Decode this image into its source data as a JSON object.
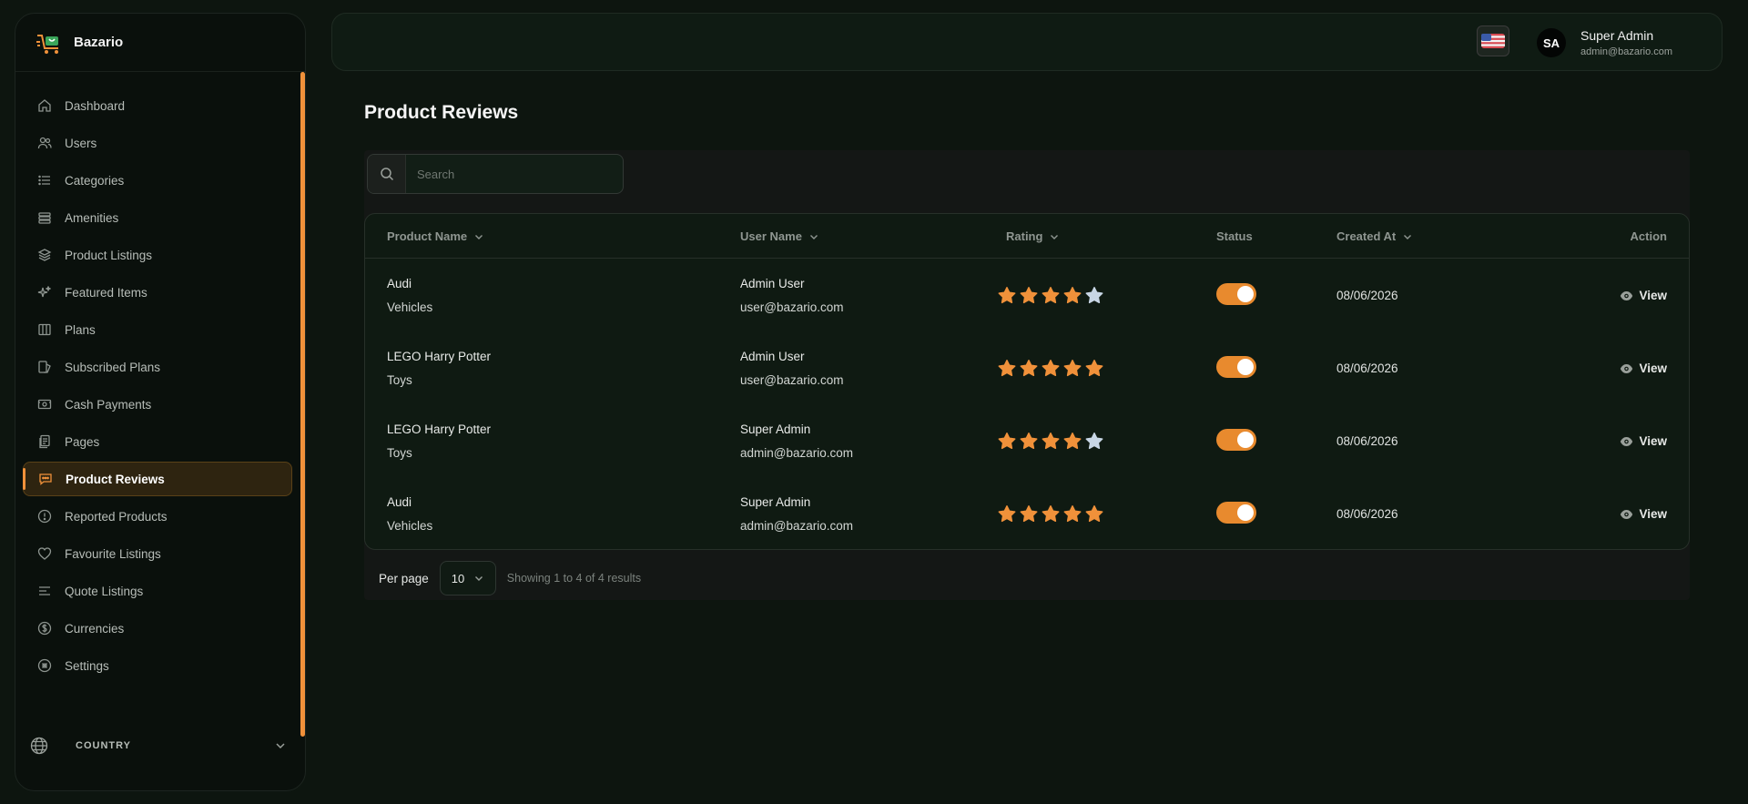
{
  "brand": {
    "name": "Bazario"
  },
  "sidebar": {
    "items": [
      {
        "label": "Dashboard",
        "icon": "home-icon",
        "active": false
      },
      {
        "label": "Users",
        "icon": "users-icon",
        "active": false
      },
      {
        "label": "Categories",
        "icon": "list-icon",
        "active": false
      },
      {
        "label": "Amenities",
        "icon": "stack-icon",
        "active": false
      },
      {
        "label": "Product Listings",
        "icon": "layers-icon",
        "active": false
      },
      {
        "label": "Featured Items",
        "icon": "sparkles-icon",
        "active": false
      },
      {
        "label": "Plans",
        "icon": "columns-icon",
        "active": false
      },
      {
        "label": "Subscribed Plans",
        "icon": "subscribed-icon",
        "active": false
      },
      {
        "label": "Cash Payments",
        "icon": "cash-icon",
        "active": false
      },
      {
        "label": "Pages",
        "icon": "pages-icon",
        "active": false
      },
      {
        "label": "Product Reviews",
        "icon": "chat-icon",
        "active": true
      },
      {
        "label": "Reported Products",
        "icon": "alert-circle-icon",
        "active": false
      },
      {
        "label": "Favourite Listings",
        "icon": "heart-icon",
        "active": false
      },
      {
        "label": "Quote Listings",
        "icon": "align-left-icon",
        "active": false
      },
      {
        "label": "Currencies",
        "icon": "dollar-circle-icon",
        "active": false
      },
      {
        "label": "Settings",
        "icon": "settings-icon",
        "active": false
      }
    ],
    "country_label": "COUNTRY"
  },
  "header": {
    "user_initials": "SA",
    "user_name": "Super Admin",
    "user_email": "admin@bazario.com"
  },
  "page": {
    "title": "Product Reviews"
  },
  "search": {
    "placeholder": "Search"
  },
  "table": {
    "columns": [
      "Product Name",
      "User Name",
      "Rating",
      "Status",
      "Created At",
      "Action"
    ],
    "rows": [
      {
        "product": "Audi",
        "category": "Vehicles",
        "user": "Admin User",
        "email": "user@bazario.com",
        "rating": 4,
        "status": true,
        "created": "08/06/2026",
        "action": "View"
      },
      {
        "product": "LEGO Harry Potter",
        "category": "Toys",
        "user": "Admin User",
        "email": "user@bazario.com",
        "rating": 5,
        "status": true,
        "created": "08/06/2026",
        "action": "View"
      },
      {
        "product": "LEGO Harry Potter",
        "category": "Toys",
        "user": "Super Admin",
        "email": "admin@bazario.com",
        "rating": 4,
        "status": true,
        "created": "08/06/2026",
        "action": "View"
      },
      {
        "product": "Audi",
        "category": "Vehicles",
        "user": "Super Admin",
        "email": "admin@bazario.com",
        "rating": 5,
        "status": true,
        "created": "08/06/2026",
        "action": "View"
      }
    ]
  },
  "pagination": {
    "per_page_label": "Per page",
    "per_page_value": "10",
    "showing": "Showing 1 to 4 of 4 results"
  },
  "colors": {
    "accent": "#f0913a",
    "star_filled": "#f0913a",
    "star_empty": "#c8d6e5",
    "toggle_on": "#e88a2e"
  }
}
